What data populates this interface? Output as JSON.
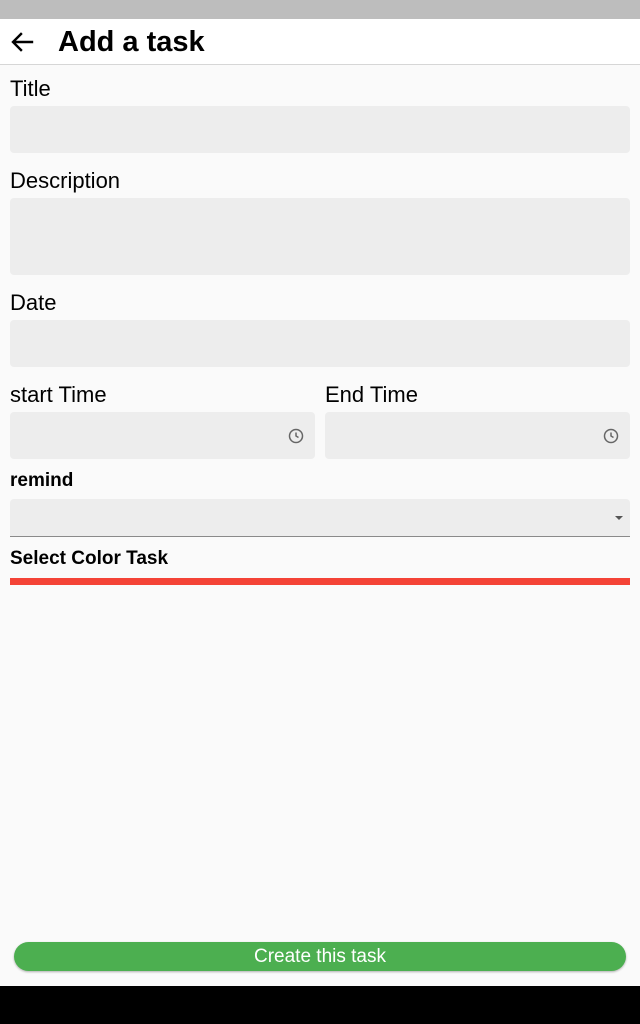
{
  "app_bar": {
    "title": "Add a task",
    "back_icon": "arrow-back-icon"
  },
  "form": {
    "title_label": "Title",
    "title_value": "",
    "description_label": "Description",
    "description_value": "",
    "date_label": "Date",
    "date_value": "",
    "start_time_label": "start Time",
    "start_time_value": "",
    "end_time_label": "End Time",
    "end_time_value": "",
    "time_icon": "clock-icon",
    "remind_label": "remind",
    "remind_value": "",
    "color_label": "Select Color Task",
    "selected_color": "#f44336"
  },
  "actions": {
    "create_label": "Create this task",
    "create_color": "#4caf50"
  }
}
